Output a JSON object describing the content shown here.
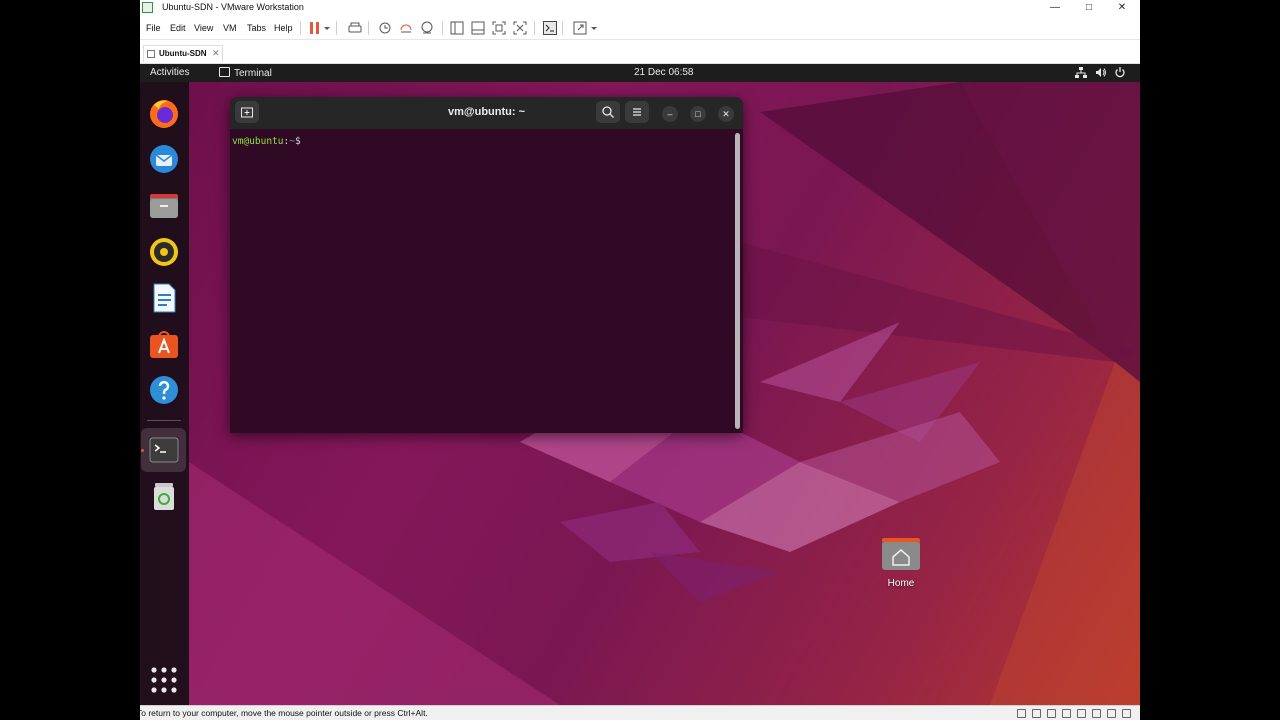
{
  "window": {
    "title": "Ubuntu-SDN - VMware Workstation",
    "controls": {
      "minimize": "—",
      "maximize": "□",
      "close": "✕"
    }
  },
  "menubar": {
    "items": [
      "File",
      "Edit",
      "View",
      "VM",
      "Tabs",
      "Help"
    ]
  },
  "toolbar": {
    "icons": [
      "pause-icon",
      "send-ctrl-alt-del-icon",
      "snapshot-icon",
      "revert-snapshot-icon",
      "snapshot-manager-icon",
      "library-icon",
      "thumbnail-icon",
      "full-screen-icon",
      "unity-icon",
      "console-view-icon",
      "stretch-icon"
    ],
    "accent": "#e4573b"
  },
  "tab": {
    "label": "Ubuntu-SDN",
    "close": "✕"
  },
  "ubuntu": {
    "activities": "Activities",
    "active_app": "Terminal",
    "clock": "21 Dec  06:58",
    "tray": [
      "network-icon",
      "volume-icon",
      "power-icon"
    ],
    "dock": [
      "firefox-icon",
      "thunderbird-icon",
      "files-icon",
      "rhythmbox-icon",
      "libreoffice-writer-icon",
      "app-center-icon",
      "help-icon",
      "terminal-icon",
      "trash-icon",
      "show-apps-icon"
    ],
    "accent": "#e95420"
  },
  "terminal": {
    "title": "vm@ubuntu: ~",
    "prompt_user": "vm@ubuntu",
    "prompt_colon": ":",
    "prompt_path": "~",
    "prompt_symbol": "$",
    "background": "#300a24"
  },
  "desktop": {
    "home_label": "Home"
  },
  "statusbar": {
    "message": "To return to your computer, move the mouse pointer outside or press Ctrl+Alt."
  }
}
